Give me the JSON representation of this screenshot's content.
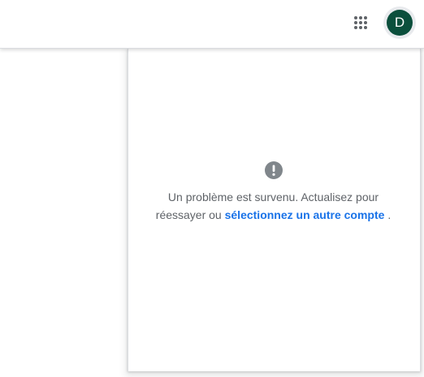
{
  "header": {
    "apps_icon": "apps-grid-icon",
    "avatar_initial": "D",
    "avatar_color": "#0b4f3c"
  },
  "panel": {
    "icon": "exclamation-circle-icon",
    "message_line": "Un problème est survenu. Actualisez pour réessayer ou",
    "link_label": "sélectionnez un autre compte",
    "message_end": ".",
    "link_color": "#1a73e8",
    "text_color": "#5f6368"
  }
}
